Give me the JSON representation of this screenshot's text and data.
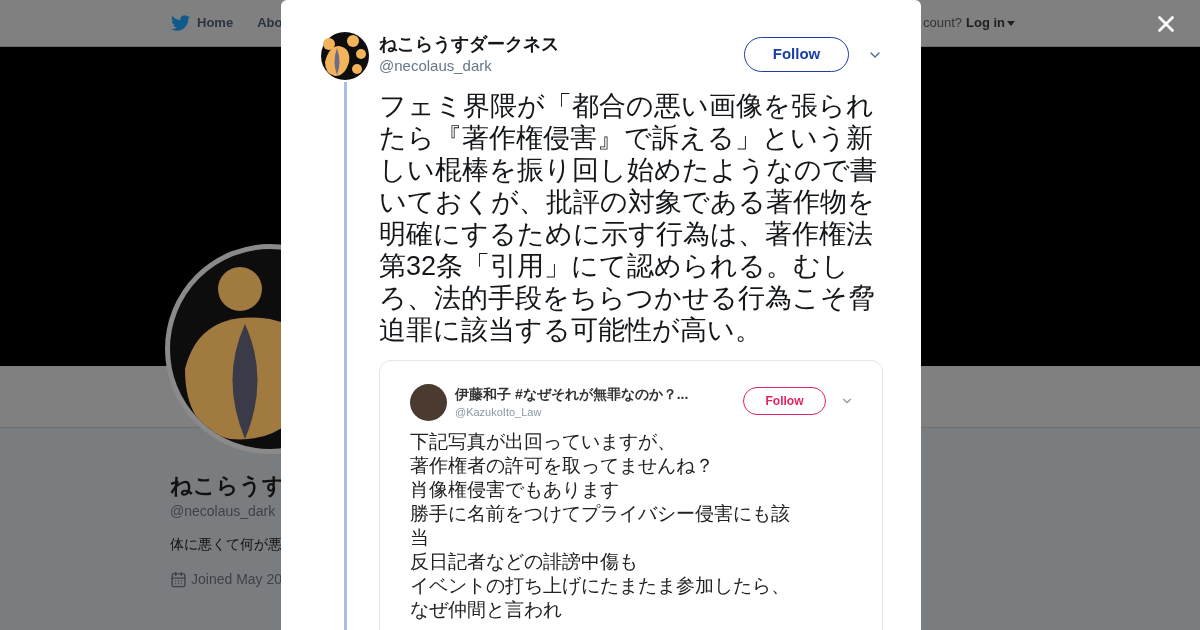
{
  "nav": {
    "home": "Home",
    "about": "Abo",
    "account_prompt": "count?",
    "login": "Log in"
  },
  "profile": {
    "name": "ねこらうす",
    "handle": "@necolaus_dark",
    "bio": "体に悪くて何が悪",
    "joined": "Joined May 20"
  },
  "tweet": {
    "name": "ねこらうすダークネス",
    "handle": "@necolaus_dark",
    "follow": "Follow",
    "text": "フェミ界隈が「都合の悪い画像を張られたら『著作権侵害』で訴える」という新しい棍棒を振り回し始めたようなので書いておくが、批評の対象である著作物を明確にするために示す行為は、著作権法第32条「引用」にて認められる。むしろ、法的手段をちらつかせる行為こそ脅迫罪に該当する可能性が高い。"
  },
  "embedded": {
    "name": "伊藤和子 #なぜそれが無罪なのか？...",
    "handle": "@KazukoIto_Law",
    "follow": "Follow",
    "lines": [
      "下記写真が出回っていますが、",
      "著作権者の許可を取ってませんね？",
      "肖像権侵害でもあります",
      "勝手に名前をつけてプライバシー侵害にも該当",
      "反日記者などの誹謗中傷も",
      "イベントの打ち上げにたまたま参加したら、",
      "なぜ仲間と言われ"
    ]
  }
}
